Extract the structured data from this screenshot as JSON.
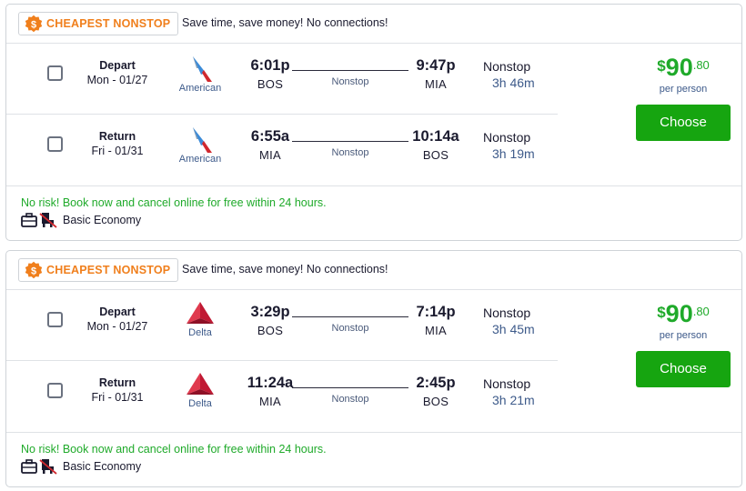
{
  "colors": {
    "badge_orange": "#f07f1c",
    "price_green": "#1faa2a",
    "button_green": "#16a510",
    "american_blue": "#3b8bd8",
    "american_red": "#d0282e",
    "delta_red": "#c01933"
  },
  "results": [
    {
      "badge": {
        "icon": "dollar-badge-icon",
        "label": "CHEAPEST NONSTOP"
      },
      "banner_text": "Save time, save money! No connections!",
      "legs": [
        {
          "direction": "Depart",
          "date": "Mon - 01/27",
          "airline": "American",
          "airline_icon": "american-airlines-logo-icon",
          "depart_time": "6:01p",
          "depart_code": "BOS",
          "arrive_time": "9:47p",
          "arrive_code": "MIA",
          "line_label": "Nonstop",
          "stops": "Nonstop",
          "duration": "3h 46m"
        },
        {
          "direction": "Return",
          "date": "Fri - 01/31",
          "airline": "American",
          "airline_icon": "american-airlines-logo-icon",
          "depart_time": "6:55a",
          "depart_code": "MIA",
          "arrive_time": "10:14a",
          "arrive_code": "BOS",
          "line_label": "Nonstop",
          "stops": "Nonstop",
          "duration": "3h 19m"
        }
      ],
      "price": {
        "currency": "$",
        "dollars": "90",
        "cents": ".80",
        "per": "per person"
      },
      "choose_label": "Choose",
      "no_risk": "No risk! Book now and cancel online for free within 24 hours.",
      "fare_icons": [
        "carry-on-bag-icon",
        "no-seat-selection-icon"
      ],
      "fare_class": "Basic Economy"
    },
    {
      "badge": {
        "icon": "dollar-badge-icon",
        "label": "CHEAPEST NONSTOP"
      },
      "banner_text": "Save time, save money! No connections!",
      "legs": [
        {
          "direction": "Depart",
          "date": "Mon - 01/27",
          "airline": "Delta",
          "airline_icon": "delta-logo-icon",
          "depart_time": "3:29p",
          "depart_code": "BOS",
          "arrive_time": "7:14p",
          "arrive_code": "MIA",
          "line_label": "Nonstop",
          "stops": "Nonstop",
          "duration": "3h 45m"
        },
        {
          "direction": "Return",
          "date": "Fri - 01/31",
          "airline": "Delta",
          "airline_icon": "delta-logo-icon",
          "depart_time": "11:24a",
          "depart_code": "MIA",
          "arrive_time": "2:45p",
          "arrive_code": "BOS",
          "line_label": "Nonstop",
          "stops": "Nonstop",
          "duration": "3h 21m"
        }
      ],
      "price": {
        "currency": "$",
        "dollars": "90",
        "cents": ".80",
        "per": "per person"
      },
      "choose_label": "Choose",
      "no_risk": "No risk! Book now and cancel online for free within 24 hours.",
      "fare_icons": [
        "carry-on-bag-icon",
        "no-seat-selection-icon"
      ],
      "fare_class": "Basic Economy"
    }
  ]
}
